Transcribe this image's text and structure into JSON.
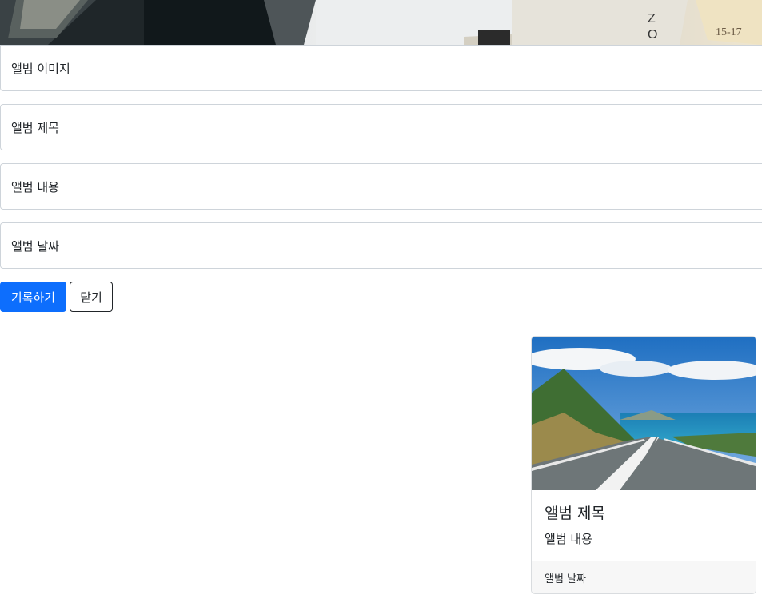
{
  "form": {
    "image_placeholder": "앨범 이미지",
    "title_placeholder": "앨범 제목",
    "content_placeholder": "앨범 내용",
    "date_placeholder": "앨범 날짜"
  },
  "buttons": {
    "submit_label": "기록하기",
    "close_label": "닫기"
  },
  "card": {
    "title": "앨범 제목",
    "text": "앨범 내용",
    "footer": "앨범 날짜"
  },
  "colors": {
    "primary": "#0d6efd"
  }
}
